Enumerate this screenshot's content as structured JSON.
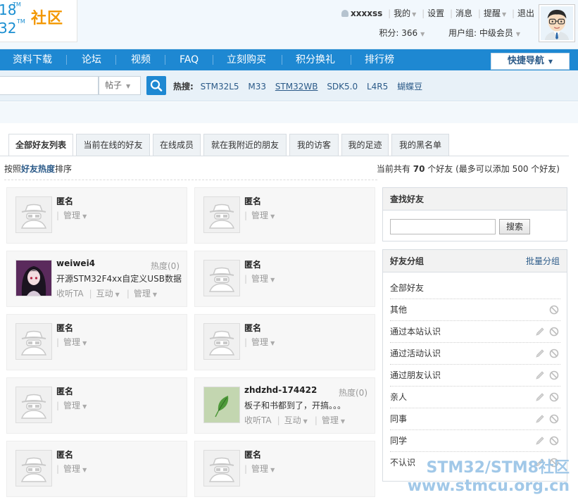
{
  "logo": {
    "num_top": "18",
    "num_bottom": "32",
    "tm": "TM",
    "name": "社区"
  },
  "userbar": {
    "username": "xxxxss",
    "links": [
      "我的",
      "设置",
      "消息",
      "提醒",
      "退出"
    ],
    "credits": "积分: 366",
    "usergroup": "用户组: 中级会员"
  },
  "nav": {
    "items": [
      "资料下载",
      "论坛",
      "视频",
      "FAQ",
      "立刻购买",
      "积分换礼",
      "排行榜"
    ],
    "quick": "快捷导航"
  },
  "search": {
    "type": "帖子",
    "hot_label": "热搜:",
    "hot_tags": [
      "STM32L5",
      "M33",
      "STM32WB",
      "SDK5.0",
      "L4R5",
      "蝴蝶豆"
    ]
  },
  "tabs": [
    "全部好友列表",
    "当前在线的好友",
    "在线成员",
    "就在我附近的朋友",
    "我的访客",
    "我的足迹",
    "我的黑名单"
  ],
  "sort": {
    "prefix": "按照",
    "key": "好友热度",
    "suffix": "排序"
  },
  "count": {
    "prefix": "当前共有",
    "num": "70",
    "suffix": "个好友 (最多可以添加 500 个好友)"
  },
  "friends": [
    {
      "name": "匿名",
      "actions": [
        "管理"
      ]
    },
    {
      "name": "匿名",
      "actions": [
        "管理"
      ]
    },
    {
      "name": "weiwei4",
      "heat": "热度(0)",
      "note": "开源STM32F4xx自定义USB数据",
      "actions": [
        "收听TA",
        "互动",
        "管理"
      ]
    },
    {
      "name": "匿名",
      "actions": [
        "管理"
      ]
    },
    {
      "name": "匿名",
      "actions": [
        "管理"
      ]
    },
    {
      "name": "匿名",
      "actions": [
        "管理"
      ]
    },
    {
      "name": "匿名",
      "actions": [
        "管理"
      ]
    },
    {
      "name": "zhdzhd-174422",
      "heat": "热度(0)",
      "note": "板子和书都到了，开搞。。。",
      "actions": [
        "收听TA",
        "互动",
        "管理"
      ]
    },
    {
      "name": "匿名",
      "actions": [
        "管理"
      ]
    },
    {
      "name": "匿名",
      "actions": [
        "管理"
      ]
    }
  ],
  "find": {
    "title": "查找好友",
    "button": "搜索"
  },
  "groups": {
    "title": "好友分组",
    "batch": "批量分组",
    "items": [
      "全部好友",
      "其他",
      "通过本站认识",
      "通过活动认识",
      "通过朋友认识",
      "亲人",
      "同事",
      "同学",
      "不认识"
    ]
  },
  "watermark": {
    "line1": "STM32/STM8社区",
    "line2": "www.stmcu.org.cn"
  },
  "colors": {
    "nav_blue": "#1e88d2",
    "link_blue": "#2b5a88",
    "logo_orange": "#f39800"
  }
}
